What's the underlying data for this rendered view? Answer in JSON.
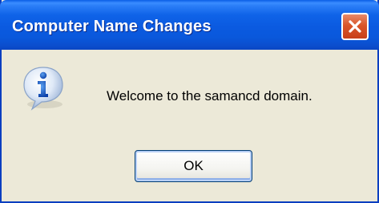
{
  "window": {
    "title": "Computer Name Changes"
  },
  "dialog": {
    "icon": "info-icon",
    "message": "Welcome to the samancd domain.",
    "ok_label": "OK"
  },
  "colors": {
    "titlebar": "#0b5ae0",
    "close_button": "#d9562a",
    "dialog_background": "#ece9d8",
    "button_border": "#003c74"
  }
}
